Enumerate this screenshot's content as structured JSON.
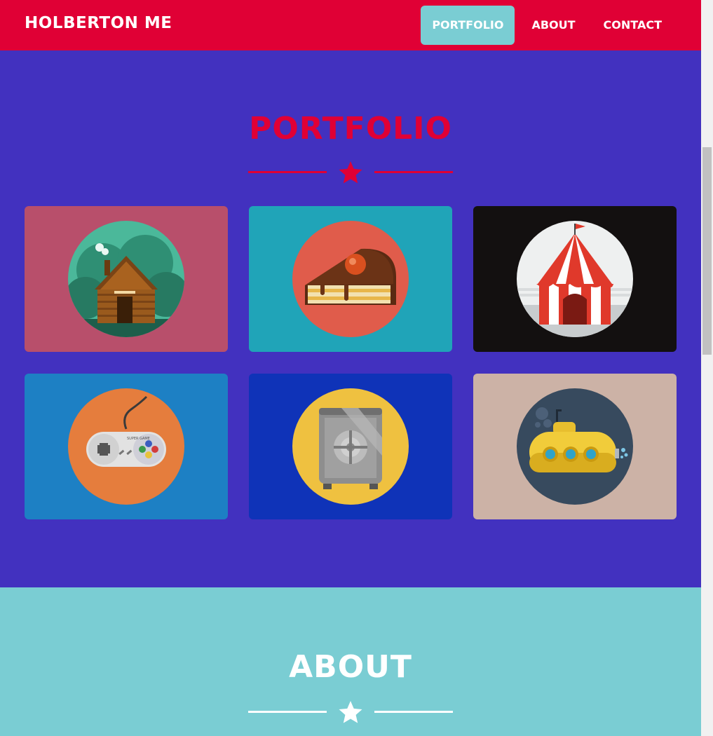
{
  "header": {
    "brand": "HOLBERTON ME",
    "nav": [
      {
        "label": "PORTFOLIO",
        "active": true
      },
      {
        "label": "ABOUT",
        "active": false
      },
      {
        "label": "CONTACT",
        "active": false
      }
    ]
  },
  "portfolio": {
    "title": "PORTFOLIO",
    "items": [
      {
        "subject": "cabin",
        "bg": "#b84f6b"
      },
      {
        "subject": "cake",
        "bg": "#20a4b8"
      },
      {
        "subject": "circus-tent",
        "bg": "#131010"
      },
      {
        "subject": "game-controller",
        "bg": "#1d80c4",
        "lettering": "SUPER GAME"
      },
      {
        "subject": "safe",
        "bg": "#0f33b8"
      },
      {
        "subject": "submarine",
        "bg": "#ccb2a6"
      }
    ]
  },
  "about": {
    "title": "ABOUT"
  },
  "colors": {
    "primary": "#e00035",
    "portfolio_bg": "#4231bf",
    "accent": "#7acdd3",
    "white": "#ffffff"
  }
}
